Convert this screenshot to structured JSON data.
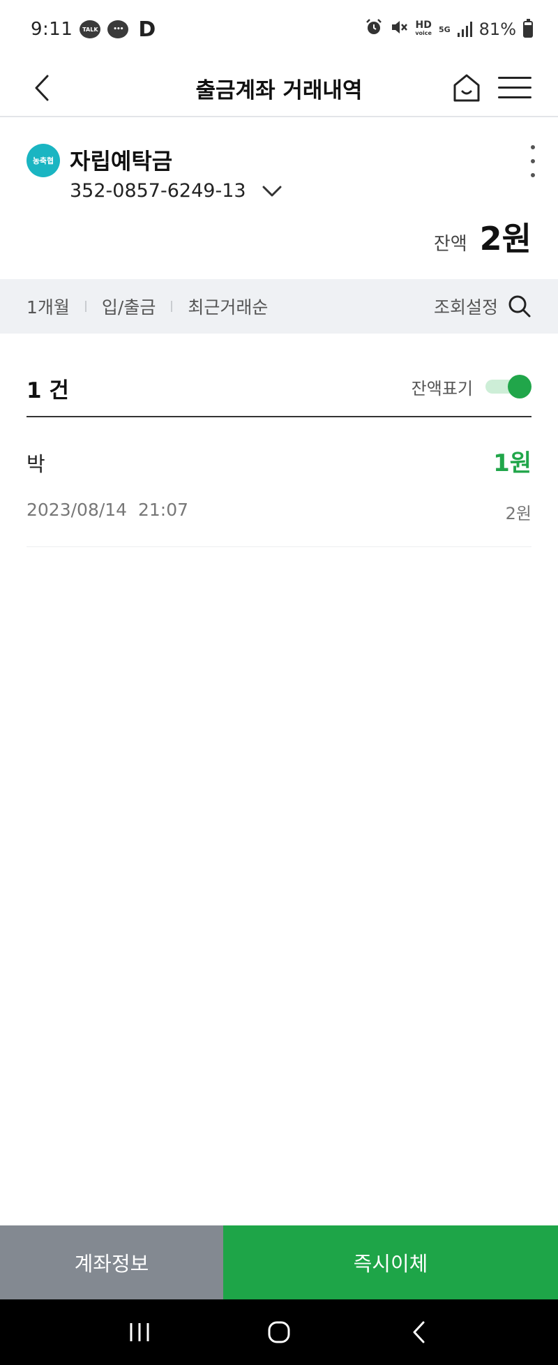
{
  "status_bar": {
    "time": "9:11",
    "talk_badge": "TALK",
    "app_letter": "D",
    "hd_label": "HD",
    "voice_label": "voice",
    "net_label": "5G",
    "battery": "81%",
    "icons": [
      "kakaotalk-icon",
      "message-icon",
      "alarm-icon",
      "mute-icon",
      "signal-icon",
      "battery-icon"
    ]
  },
  "header": {
    "title": "출금계좌 거래내역",
    "icons": [
      "back-icon",
      "home-icon",
      "menu-icon"
    ]
  },
  "account": {
    "bank_logo_text": "농축협",
    "name": "자립예탁금",
    "number": "352-0857-6249-13",
    "balance_label": "잔액",
    "balance_value": "2원",
    "brand_color": "#1ab5c2"
  },
  "filters": {
    "period": "1개월",
    "type": "입/출금",
    "order": "최근거래순",
    "search_label": "조회설정"
  },
  "list": {
    "count": "1 건",
    "balance_toggle_label": "잔액표기",
    "balance_toggle_on": true,
    "transactions": [
      {
        "name": "박",
        "amount": "1원",
        "date": "2023/08/14  21:07",
        "balance": "2원"
      }
    ]
  },
  "bottom": {
    "account_info": "계좌정보",
    "instant_transfer": "즉시이체",
    "accent_color": "#1ea548"
  }
}
